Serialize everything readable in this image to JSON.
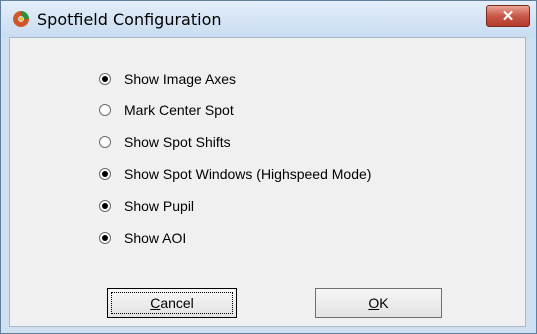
{
  "window": {
    "title": "Spotfield Configuration",
    "close_label": "✕"
  },
  "options": [
    {
      "label": "Show Image Axes",
      "checked": true
    },
    {
      "label": "Mark Center Spot",
      "checked": false
    },
    {
      "label": "Show Spot Shifts",
      "checked": false
    },
    {
      "label": "Show Spot Windows (Highspeed Mode)",
      "checked": true
    },
    {
      "label": "Show Pupil",
      "checked": true
    },
    {
      "label": "Show AOI",
      "checked": true
    }
  ],
  "buttons": {
    "cancel_accel": "C",
    "cancel_rest": "ancel",
    "ok_accel": "O",
    "ok_rest": "K"
  }
}
